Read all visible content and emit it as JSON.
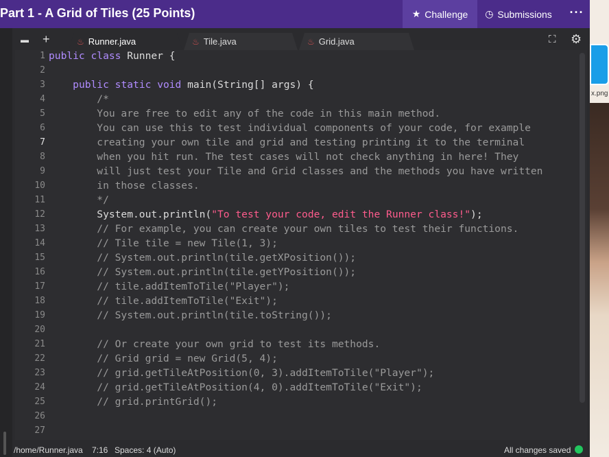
{
  "header": {
    "title": "Part 1 - A Grid of Tiles (25 Points)",
    "challenge_label": "Challenge",
    "submissions_label": "Submissions",
    "more_label": "···"
  },
  "side": {
    "png_text": "x.png"
  },
  "tabs": [
    {
      "label": "Runner.java",
      "active": true
    },
    {
      "label": "Tile.java",
      "active": false
    },
    {
      "label": "Grid.java",
      "active": false
    }
  ],
  "code_lines": [
    "public class Runner {",
    "",
    "    public static void main(String[] args) {",
    "        /*",
    "        You are free to edit any of the code in this main method.",
    "        You can use this to test individual components of your code, for example",
    "        creating your own tile and grid and testing printing it to the terminal",
    "        when you hit run. The test cases will not check anything in here! They",
    "        will just test your Tile and Grid classes and the methods you have written",
    "        in those classes.",
    "        */",
    "        System.out.println(\"To test your code, edit the Runner class!\");",
    "        // For example, you can create your own tiles to test their functions.",
    "        // Tile tile = new Tile(1, 3);",
    "        // System.out.println(tile.getXPosition());",
    "        // System.out.println(tile.getYPosition());",
    "        // tile.addItemToTile(\"Player\");",
    "        // tile.addItemToTile(\"Exit\");",
    "        // System.out.println(tile.toString());",
    "",
    "        // Or create your own grid to test its methods.",
    "        // Grid grid = new Grid(5, 4);",
    "        // grid.getTileAtPosition(0, 3).addItemToTile(\"Player\");",
    "        // grid.getTileAtPosition(4, 0).addItemToTile(\"Exit\");",
    "        // grid.printGrid();",
    "",
    ""
  ],
  "current_line": 7,
  "status": {
    "path": "/home/Runner.java",
    "position": "7:16",
    "spaces": "Spaces: 4 (Auto)",
    "saved": "All changes saved",
    "saved_color": "#22c55e"
  },
  "colors": {
    "header_bg": "#4b2c8a",
    "keyword": "#b08cff",
    "comment": "#9a9a9a",
    "string": "#ff5c8d"
  }
}
